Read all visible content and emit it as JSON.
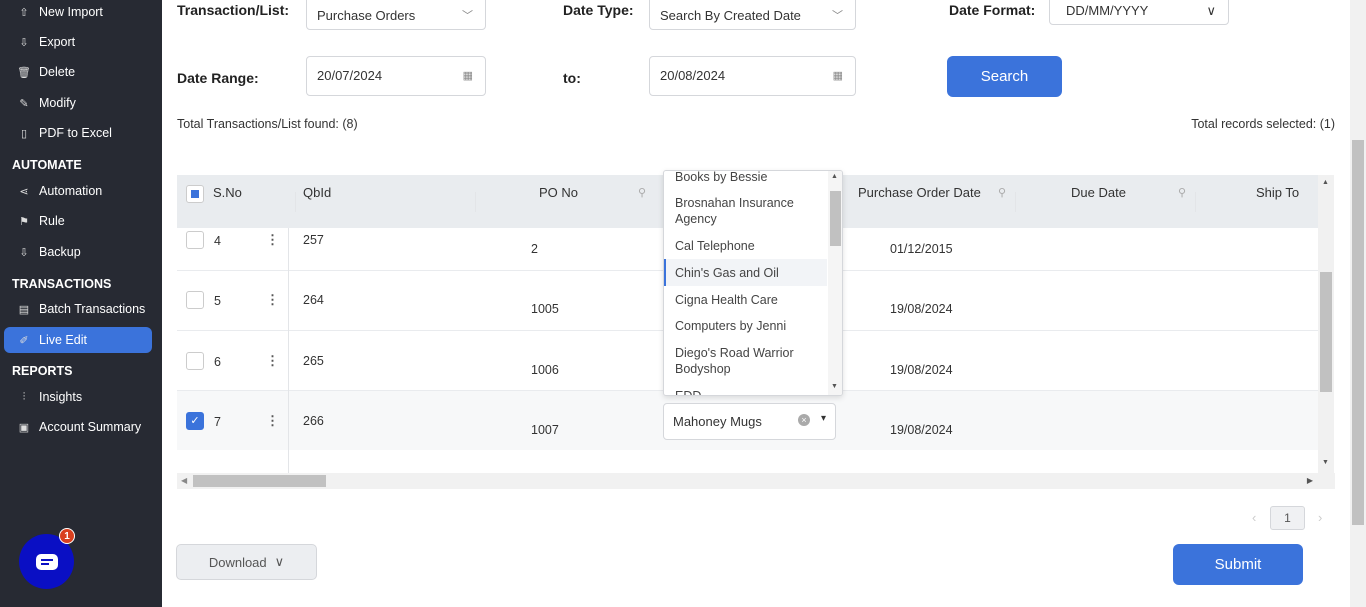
{
  "sidebar": {
    "items": [
      {
        "label": "New Import",
        "icon": "cloud-upload-icon"
      },
      {
        "label": "Export",
        "icon": "cloud-download-icon"
      },
      {
        "label": "Delete",
        "icon": "trash-icon"
      },
      {
        "label": "Modify",
        "icon": "edit-file-icon"
      },
      {
        "label": "PDF to Excel",
        "icon": "pdf-file-icon"
      }
    ],
    "automate": {
      "title": "AUTOMATE",
      "items": [
        {
          "label": "Automation",
          "icon": "share-icon"
        },
        {
          "label": "Rule",
          "icon": "rule-icon"
        },
        {
          "label": "Backup",
          "icon": "cloud-backup-icon"
        }
      ]
    },
    "transactions": {
      "title": "TRANSACTIONS",
      "items": [
        {
          "label": "Batch Transactions",
          "icon": "document-icon"
        },
        {
          "label": "Live Edit",
          "icon": "live-edit-icon",
          "active": true
        }
      ]
    },
    "reports": {
      "title": "REPORTS",
      "items": [
        {
          "label": "Insights",
          "icon": "sliders-icon"
        },
        {
          "label": "Account Summary",
          "icon": "clipboard-icon"
        }
      ]
    },
    "chat_badge": "1"
  },
  "filters": {
    "transaction_label": "Transaction/List:",
    "transaction_value": "Purchase Orders",
    "date_type_label": "Date Type:",
    "date_type_value": "Search By Created Date",
    "date_format_label": "Date Format:",
    "date_format_value": "DD/MM/YYYY",
    "date_range_label": "Date Range:",
    "from_date": "20/07/2024",
    "to_label": "to:",
    "to_date": "20/08/2024",
    "search_label": "Search"
  },
  "summary": {
    "found": "Total Transactions/List found: (8)",
    "selected": "Total records selected: (1)"
  },
  "table": {
    "headers": [
      "S.No",
      "QbId",
      "PO No",
      "Purchase Order Date",
      "Due Date",
      "Ship To"
    ],
    "rows": [
      {
        "sno": "4",
        "qbid": "257",
        "po": "2",
        "date": "01/12/2015",
        "checked": false
      },
      {
        "sno": "5",
        "qbid": "264",
        "po": "1005",
        "date": "19/08/2024",
        "checked": false
      },
      {
        "sno": "6",
        "qbid": "265",
        "po": "1006",
        "date": "19/08/2024",
        "checked": false
      },
      {
        "sno": "7",
        "qbid": "266",
        "po": "1007",
        "date": "19/08/2024",
        "checked": true
      }
    ],
    "vendor_value": "Mahoney Mugs",
    "dropdown_options": [
      "Books by Bessie",
      "Brosnahan Insurance Agency",
      "Cal Telephone",
      "Chin's Gas and Oil",
      "Cigna Health Care",
      "Computers by Jenni",
      "Diego's Road Warrior Bodyshop",
      "EDD"
    ],
    "highlighted_option": "Chin's Gas and Oil"
  },
  "pagination": {
    "page": "1"
  },
  "footer": {
    "download_label": "Download",
    "submit_label": "Submit"
  },
  "colors": {
    "sidebar": "#272a33",
    "accent": "#3b73db",
    "header": "#e9ecef",
    "chat": "#0a0fc4"
  }
}
